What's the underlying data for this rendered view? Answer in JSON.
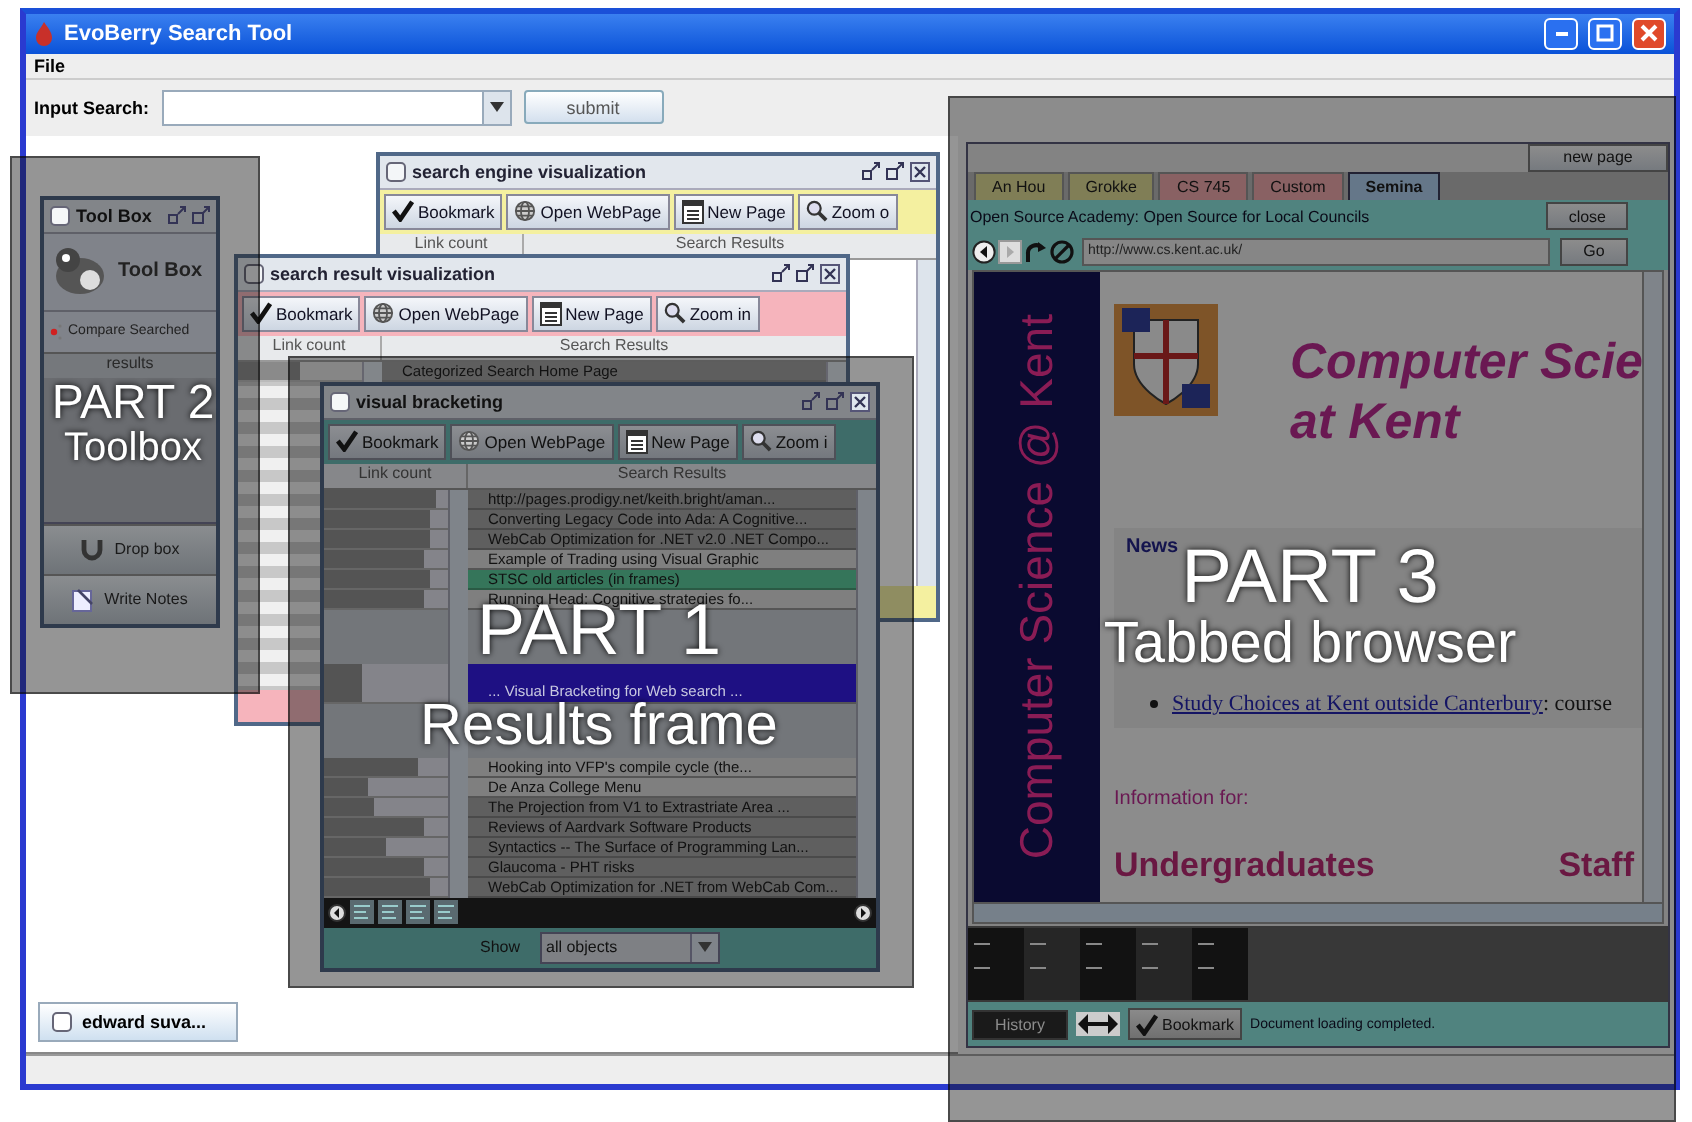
{
  "window": {
    "title": "EvoBerry Search Tool"
  },
  "menu": [
    {
      "label": "File"
    }
  ],
  "search": {
    "label": "Input Search:",
    "button": "submit"
  },
  "toolbox": {
    "title": "Tool Box",
    "heading": "Tool Box",
    "compare": "Compare Searched",
    "results_header": "results",
    "buttons": [
      {
        "kind": "drop",
        "label": "Drop box"
      },
      {
        "kind": "notes",
        "label": "Write Notes"
      }
    ]
  },
  "frames": [
    {
      "kind": "engine",
      "title": "search engine visualization",
      "color": "#f4f0a0",
      "toolbar": [
        {
          "kind": "bookmark",
          "label": "Bookmark"
        },
        {
          "kind": "open",
          "label": "Open WebPage"
        },
        {
          "kind": "new",
          "label": "New Page"
        },
        {
          "kind": "zoom",
          "label": "Zoom o"
        }
      ],
      "columns": [
        "Link count",
        "Search Results"
      ]
    },
    {
      "kind": "result",
      "title": "search result visualization",
      "color": "#f6b4bc",
      "toolbar": [
        {
          "kind": "bookmark",
          "label": "Bookmark"
        },
        {
          "kind": "open",
          "label": "Open WebPage"
        },
        {
          "kind": "new",
          "label": "New Page"
        },
        {
          "kind": "zoom",
          "label": "Zoom in"
        }
      ],
      "columns": [
        "Link count",
        "Search Results"
      ],
      "rows": [
        {
          "kind": "dark",
          "selected": false,
          "level": 0.5,
          "text": "Categorized Search Home Page"
        }
      ]
    },
    {
      "kind": "bracketing",
      "title": "visual bracketing",
      "color": "#3e6c69",
      "toolbar": [
        {
          "kind": "bookmark",
          "label": "Bookmark"
        },
        {
          "kind": "open",
          "label": "Open WebPage"
        },
        {
          "kind": "new",
          "label": "New Page"
        },
        {
          "kind": "zoom",
          "label": "Zoom i"
        }
      ],
      "columns": [
        "Link count",
        "Search Results"
      ],
      "rows": [
        {
          "kind": "dark",
          "selected": false,
          "level": 0.9,
          "text": "http://pages.prodigy.net/keith.bright/aman..."
        },
        {
          "kind": "dark",
          "selected": false,
          "level": 0.85,
          "text": "Converting Legacy Code into Ada: A Cognitive..."
        },
        {
          "kind": "dark",
          "selected": false,
          "level": 0.85,
          "text": "WebCab Optimization for .NET v2.0 .NET Compo..."
        },
        {
          "kind": "light",
          "selected": false,
          "level": 0.8,
          "text": "Example of Trading using Visual Graphic"
        },
        {
          "kind": "green",
          "selected": false,
          "level": 0.85,
          "text": "STSC old articles (in frames)"
        },
        {
          "kind": "light",
          "selected": false,
          "level": 0.8,
          "text": "Running Head: Cognitive strategies fo..."
        },
        {
          "kind": "gap"
        },
        {
          "kind": "light",
          "selected": true,
          "level": 0.3,
          "text": "... Visual Bracketing for Web search ..."
        },
        {
          "kind": "gap"
        },
        {
          "kind": "light",
          "selected": false,
          "level": 0.75,
          "text": "Hooking into VFP's compile cycle (the..."
        },
        {
          "kind": "light",
          "selected": false,
          "level": 0.35,
          "text": "De Anza College Menu"
        },
        {
          "kind": "dark",
          "selected": false,
          "level": 0.4,
          "text": "The Projection from V1 to Extrastriate Area ..."
        },
        {
          "kind": "dark",
          "selected": false,
          "level": 0.8,
          "text": "Reviews of Aardvark Software Products"
        },
        {
          "kind": "dark",
          "selected": false,
          "level": 0.5,
          "text": "Syntactics -- The Surface of Programming Lan..."
        },
        {
          "kind": "dark",
          "selected": false,
          "level": 0.8,
          "text": "Glaucoma - PHT risks"
        },
        {
          "kind": "dark",
          "selected": false,
          "level": 0.85,
          "text": "WebCab Optimization for .NET from WebCab Com..."
        }
      ],
      "show": {
        "label": "Show",
        "value": "all objects"
      }
    }
  ],
  "browser": {
    "new_page": "new page",
    "tabs": [
      {
        "label": "An Hou",
        "color": "#807e56",
        "selected": false
      },
      {
        "label": "Grokke",
        "color": "#807e56",
        "selected": false
      },
      {
        "label": "CS 745",
        "color": "#896163",
        "selected": false
      },
      {
        "label": "Custom",
        "color": "#896163",
        "selected": false
      },
      {
        "label": "Semina",
        "color": "#657789",
        "selected": true
      }
    ],
    "page_title": "Open Source Academy: Open Source for Local Councils",
    "close": "close",
    "url": "http://www.cs.kent.ac.uk/",
    "go": "Go",
    "page": {
      "side_title": "Computer Science @ Kent",
      "heading": [
        "Computer Scie",
        "at Kent"
      ],
      "news_title": "News",
      "news": [
        {
          "link": "Study Choices at Kent outside Canterbury",
          "note": ": course"
        }
      ],
      "info_title": "Information for:",
      "audiences": [
        "Undergraduates",
        "Staff"
      ]
    },
    "history": {
      "label": "History",
      "disabled": true
    },
    "bookmark": "Bookmark",
    "status": "Document loading completed."
  },
  "taskbar": [
    {
      "label": "edward suva..."
    }
  ],
  "annotations": [
    {
      "kind": "results",
      "title": "PART 1",
      "subtitle": "Results frame"
    },
    {
      "kind": "toolbox",
      "title": "PART 2",
      "subtitle": "Toolbox"
    },
    {
      "kind": "browser",
      "title": "PART 3",
      "subtitle": "Tabbed browser"
    }
  ]
}
